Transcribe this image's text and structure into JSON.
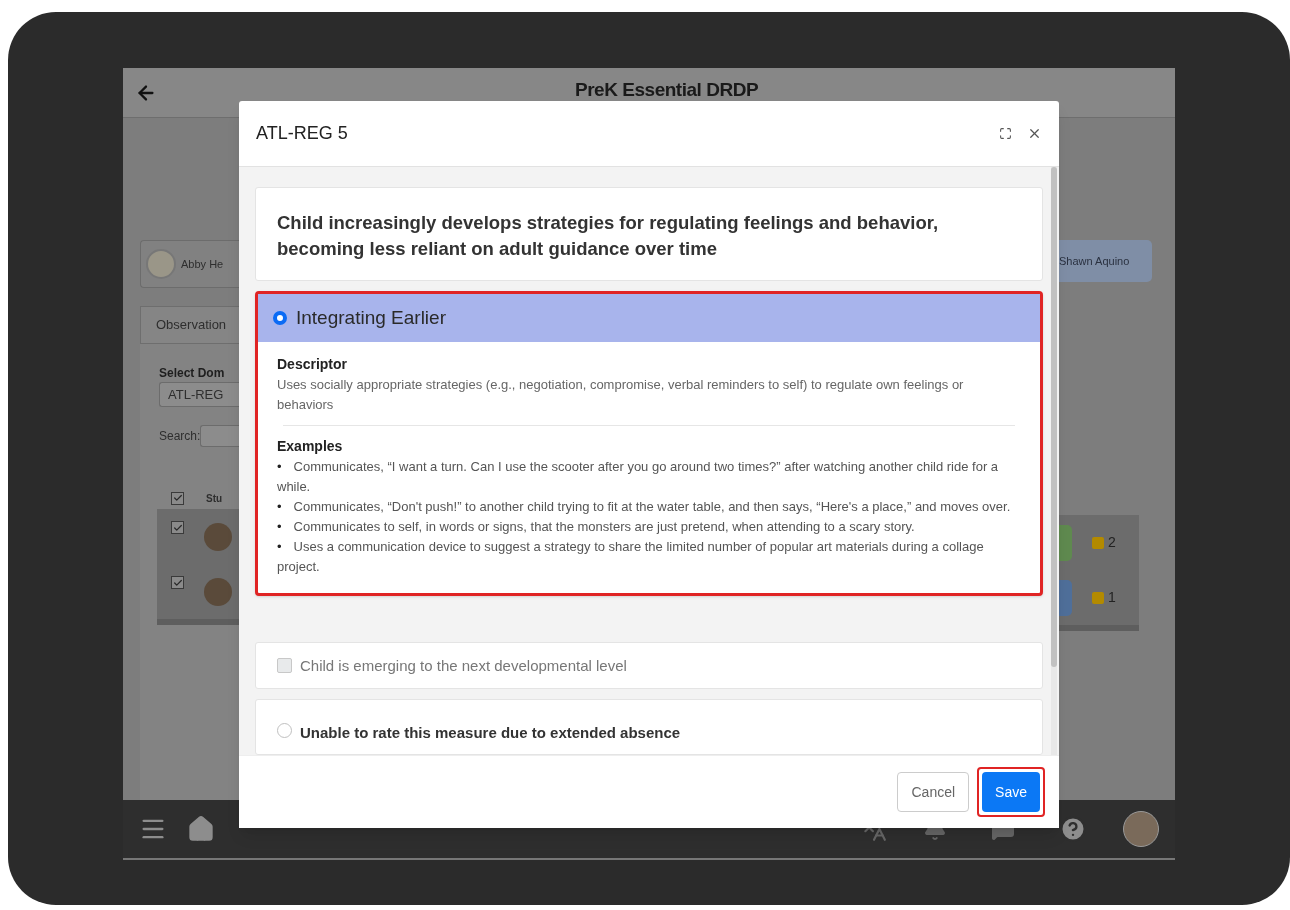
{
  "app_header": {
    "title": "PreK Essential DRDP"
  },
  "background": {
    "left": {
      "child_chip": "Abby He",
      "tab": "Observation",
      "domain_label": "Select Dom",
      "domain_value": "ATL-REG",
      "search_label": "Search:",
      "column_header": "Stu",
      "header_checked": true,
      "rows": [
        {
          "checked": true
        },
        {
          "checked": true
        }
      ]
    },
    "right": {
      "child_chip": "Shawn Aquino",
      "rows": [
        {
          "color": "#5f8a4f",
          "count": "2"
        },
        {
          "color": "#4f6f9a",
          "count": "1"
        }
      ]
    }
  },
  "modal": {
    "title": "ATL-REG 5",
    "measure": "Child increasingly develops strategies for regulating feelings and behavior, becoming less reliant on adult guidance over time",
    "level": {
      "name": "Integrating Earlier",
      "selected": true,
      "highlighted": true,
      "descriptor_heading": "Descriptor",
      "descriptor": "Uses socially appropriate strategies (e.g., negotiation, compromise, verbal reminders to self) to regulate own feelings or behaviors",
      "examples_heading": "Examples",
      "examples": [
        {
          "bullet": "•",
          "text": "Communicates, “I want a turn. Can I use the scooter after you go around two times?” after watching another child ride for a while."
        },
        {
          "bullet": "•",
          "text": "Communicates, “Don't push!” to another child trying to fit at the water table, and then says, “Here's a place,” and moves over."
        },
        {
          "bullet": "•",
          "text": "Communicates to self, in words or signs, that the monsters are just pretend, when attending to a scary story."
        },
        {
          "bullet": "•",
          "text": "Uses a communication device to suggest a strategy to share the limited number of popular art materials during a collage project."
        }
      ]
    },
    "emerging": {
      "label": "Child is emerging to the next developmental level",
      "checked": false
    },
    "absence": {
      "label": "Unable to rate this measure due to extended absence",
      "selected": false
    },
    "buttons": [
      {
        "label": "Cancel",
        "kind": "secondary",
        "highlighted": false
      },
      {
        "label": "Save",
        "kind": "primary",
        "highlighted": true
      }
    ]
  }
}
